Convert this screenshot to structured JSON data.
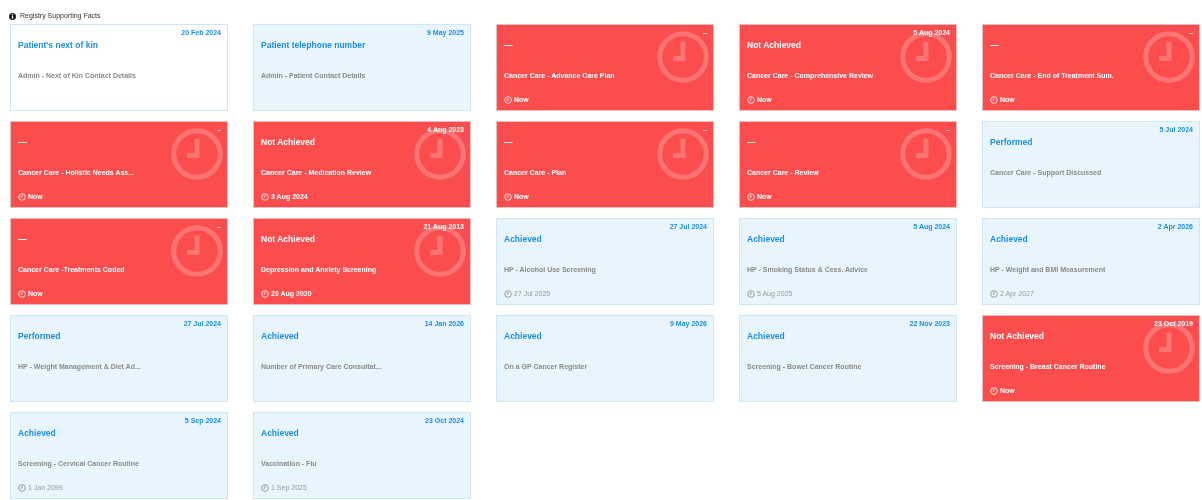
{
  "header": {
    "title": "Registry Supporting Facts"
  },
  "cards": [
    {
      "kind": "plain",
      "date": "20 Feb 2024",
      "status": "Patient's next of kin",
      "name": "Admin - Next of Kin Contact Details"
    },
    {
      "kind": "info",
      "date": "9 May 2025",
      "status": "Patient telephone number",
      "name": "Admin - Patient Contact Details"
    },
    {
      "kind": "alert",
      "date": "–",
      "status": "—",
      "name": "Cancer Care - Advance Care Plan",
      "due": "Now"
    },
    {
      "kind": "alert",
      "date": "5 Aug 2024",
      "status": "Not Achieved",
      "name": "Cancer Care - Comprehensive Review",
      "due": "Now"
    },
    {
      "kind": "alert",
      "date": "–",
      "status": "—",
      "name": "Cancer Care - End of Treatment Sum.",
      "due": "Now"
    },
    {
      "kind": "alert",
      "date": "–",
      "status": "—",
      "name": "Cancer Care - Holistic Needs Ass...",
      "due": "Now"
    },
    {
      "kind": "alert",
      "date": "4 Aug 2023",
      "status": "Not Achieved",
      "name": "Cancer Care - Medication Review",
      "due": "3 Aug 2024"
    },
    {
      "kind": "alert",
      "date": "–",
      "status": "—",
      "name": "Cancer Care - Plan",
      "due": "Now"
    },
    {
      "kind": "alert",
      "date": "–",
      "status": "—",
      "name": "Cancer Care - Review",
      "due": "Now"
    },
    {
      "kind": "info",
      "date": "5 Jul 2024",
      "status": "Performed",
      "name": "Cancer Care - Support Discussed"
    },
    {
      "kind": "alert",
      "date": "–",
      "status": "—",
      "name": "Cancer Care -Treatments Coded",
      "due": "Now"
    },
    {
      "kind": "alert",
      "date": "21 Aug 2013",
      "status": "Not Achieved",
      "name": "Depression and Anxiety Screening",
      "due": "20 Aug 2020"
    },
    {
      "kind": "info",
      "date": "27 Jul 2024",
      "status": "Achieved",
      "name": "HP - Alcohol Use Screening",
      "due": "27 Jul 2025"
    },
    {
      "kind": "info",
      "date": "5 Aug 2024",
      "status": "Achieved",
      "name": "HP - Smoking Status & Cess. Advice",
      "due": "5 Aug 2025"
    },
    {
      "kind": "info",
      "date": "2 Apr 2026",
      "status": "Achieved",
      "name": "HP - Weight and BMI Measurement",
      "due": "2 Apr 2027"
    },
    {
      "kind": "info",
      "date": "27 Jul 2024",
      "status": "Performed",
      "name": "HP - Weight Management & Diet Ad..."
    },
    {
      "kind": "info",
      "date": "14 Jan 2026",
      "status": "Achieved",
      "name": "Number of Primary Care Consultat..."
    },
    {
      "kind": "info",
      "date": "9 May 2026",
      "status": "Achieved",
      "name": "On a GP Cancer Register"
    },
    {
      "kind": "info",
      "date": "22 Nov 2023",
      "status": "Achieved",
      "name": "Screening - Bowel Cancer Routine"
    },
    {
      "kind": "alert",
      "date": "23 Oct 2019",
      "status": "Not Achieved",
      "name": "Screening - Breast Cancer Routine",
      "due": "Now"
    },
    {
      "kind": "info",
      "date": "5 Sep 2024",
      "status": "Achieved",
      "name": "Screening - Cervical Cancer Routine",
      "due": "1 Jan 2099"
    },
    {
      "kind": "info",
      "date": "23 Oct 2024",
      "status": "Achieved",
      "name": "Vaccination - Flu",
      "due": "1 Sep 2025"
    }
  ]
}
